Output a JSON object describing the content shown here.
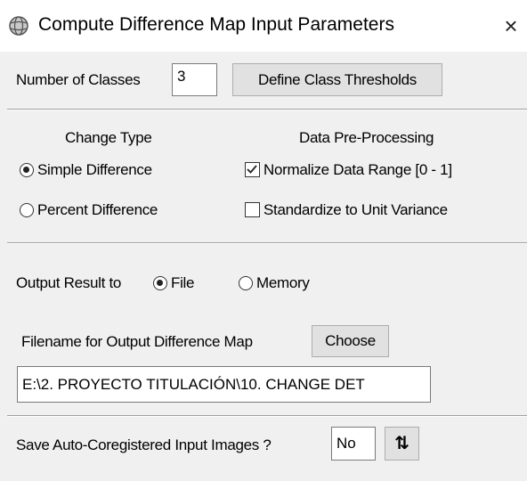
{
  "window": {
    "title": "Compute Difference Map Input Parameters",
    "close_glyph": "×",
    "icon": "app-globe-icon"
  },
  "classes": {
    "label": "Number of Classes",
    "value": "3",
    "define_button": "Define Class Thresholds"
  },
  "change_type": {
    "heading": "Change Type",
    "options": [
      {
        "label": "Simple Difference",
        "selected": true
      },
      {
        "label": "Percent Difference",
        "selected": false
      }
    ]
  },
  "preprocessing": {
    "heading": "Data Pre-Processing",
    "options": [
      {
        "label": "Normalize Data Range [0 - 1]",
        "checked": true
      },
      {
        "label": "Standardize to Unit Variance",
        "checked": false
      }
    ]
  },
  "output": {
    "label": "Output Result to",
    "options": [
      {
        "label": "File",
        "selected": true
      },
      {
        "label": "Memory",
        "selected": false
      }
    ]
  },
  "filename": {
    "label": "Filename for Output Difference Map",
    "choose_button": "Choose",
    "value": "E:\\2. PROYECTO TITULACIÓN\\10. CHANGE DET"
  },
  "coregister": {
    "label": "Save Auto-Coregistered Input Images ?",
    "value": "No",
    "toggle_icon": "sort-arrows-icon",
    "toggle_glyph": "⇅"
  }
}
